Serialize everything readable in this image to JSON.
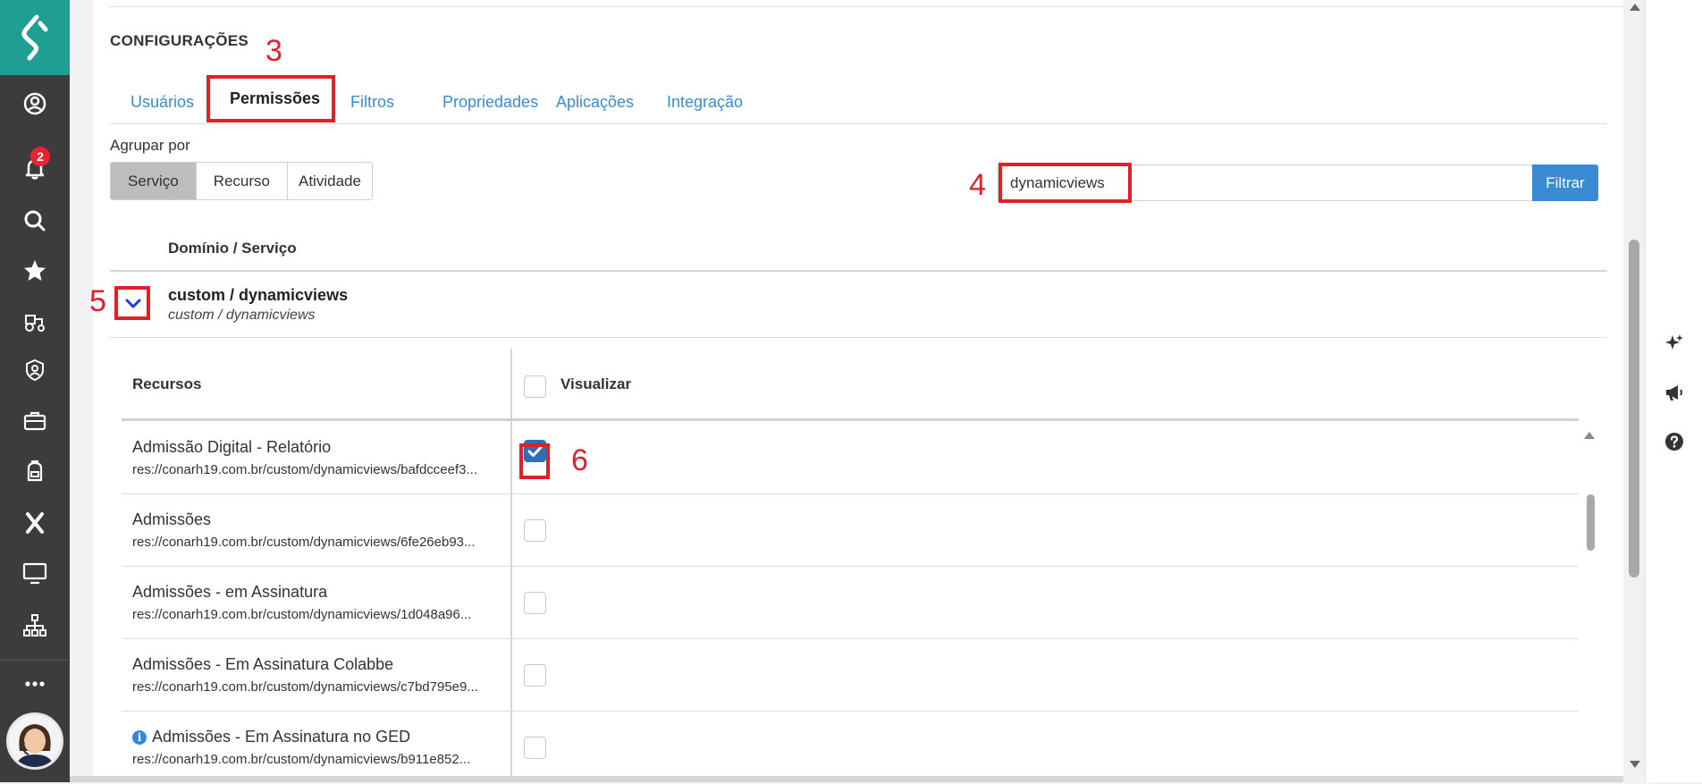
{
  "sidebar": {
    "notification_count": "2"
  },
  "section": {
    "title": "CONFIGURAÇÕES"
  },
  "tabs": [
    {
      "label": "Usuários"
    },
    {
      "label": "Permissões"
    },
    {
      "label": "Filtros"
    },
    {
      "label": "Propriedades"
    },
    {
      "label": "Aplicações"
    },
    {
      "label": "Integração"
    }
  ],
  "groupby": {
    "label": "Agrupar por",
    "options": [
      "Serviço",
      "Recurso",
      "Atividade"
    ],
    "selected": "Serviço"
  },
  "search": {
    "value": "dynamicviews",
    "button_label": "Filtrar"
  },
  "domain": {
    "column_header": "Domínio / Serviço",
    "title": "custom / dynamicviews",
    "subtitle": "custom / dynamicviews"
  },
  "resources": {
    "header_left": "Recursos",
    "header_right": "Visualizar",
    "rows": [
      {
        "name": "Admissão Digital - Relatório",
        "path": "res://conarh19.com.br/custom/dynamicviews/bafdcceef3...",
        "checked": true,
        "info": false
      },
      {
        "name": "Admissões",
        "path": "res://conarh19.com.br/custom/dynamicviews/6fe26eb93...",
        "checked": false,
        "info": false
      },
      {
        "name": "Admissões - em Assinatura",
        "path": "res://conarh19.com.br/custom/dynamicviews/1d048a96...",
        "checked": false,
        "info": false
      },
      {
        "name": "Admissões - Em Assinatura Colabbe",
        "path": "res://conarh19.com.br/custom/dynamicviews/c7bd795e9...",
        "checked": false,
        "info": false
      },
      {
        "name": "Admissões - Em Assinatura no GED",
        "path": "res://conarh19.com.br/custom/dynamicviews/b911e852...",
        "checked": false,
        "info": true
      }
    ]
  },
  "annotations": {
    "tab_marker": "3",
    "search_marker": "4",
    "expand_marker": "5",
    "checkbox_marker": "6"
  },
  "colors": {
    "accent": "#3a8bd1",
    "brand": "#1f9e93",
    "annotation": "#e0212b",
    "sidebar": "#3c3c3c"
  }
}
